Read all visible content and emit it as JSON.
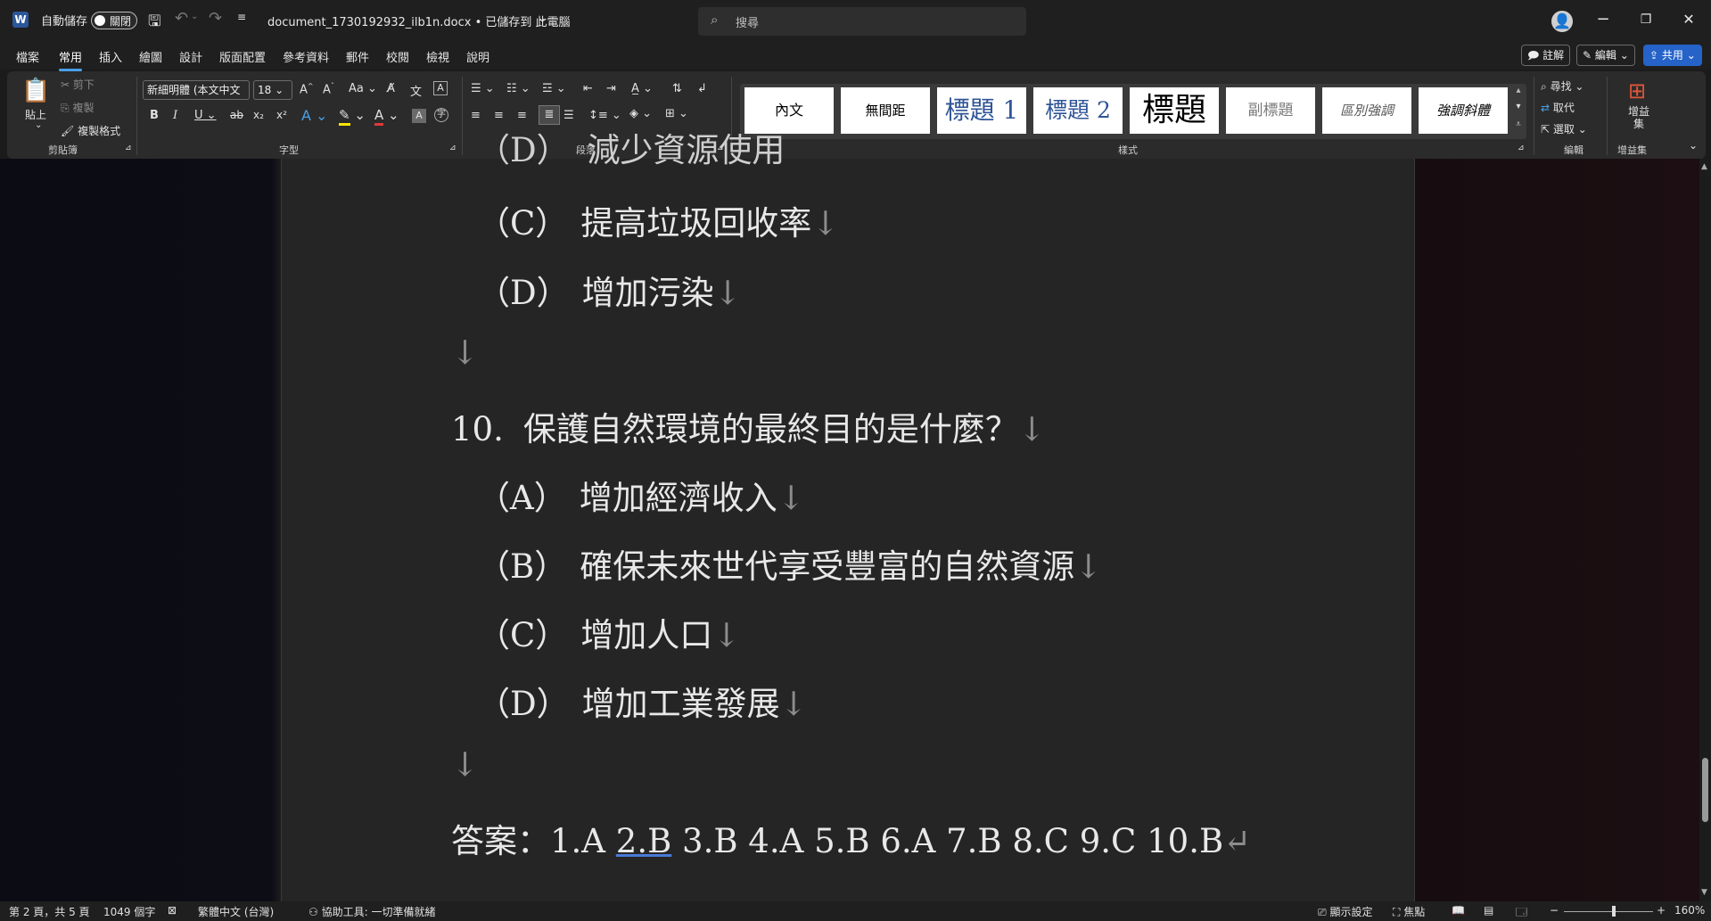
{
  "titlebar": {
    "autosave_label": "自動儲存",
    "autosave_state": "關閉",
    "doc_title": "document_1730192932_ilb1n.docx • 已儲存到 此電腦",
    "search_placeholder": "搜尋",
    "minimize": "−",
    "restore": "❐",
    "close": "✕"
  },
  "menu": {
    "tabs": [
      "檔案",
      "常用",
      "插入",
      "繪圖",
      "設計",
      "版面配置",
      "參考資料",
      "郵件",
      "校閱",
      "檢視",
      "說明"
    ],
    "active": "常用",
    "comments": "註解",
    "editing": "編輯",
    "share": "共用"
  },
  "ribbon": {
    "clipboard": {
      "paste": "貼上",
      "cut": "剪下",
      "copy": "複製",
      "format_painter": "複製格式",
      "label": "剪貼簿"
    },
    "font": {
      "name": "新細明體 (本文中文",
      "size": "18",
      "label": "字型",
      "grow": "A^",
      "shrink": "Aˇ",
      "case": "Aa"
    },
    "paragraph": {
      "label": "段落"
    },
    "styles": {
      "label": "樣式",
      "items": [
        "內文",
        "無間距",
        "標題 1",
        "標題 2",
        "標題",
        "副標題",
        "區別強調",
        "強調斜體"
      ]
    },
    "editing": {
      "find": "尋找",
      "replace": "取代",
      "select": "選取",
      "label": "編輯"
    },
    "addins": {
      "button": "增益集",
      "label": "增益集"
    }
  },
  "document": {
    "lines": [
      {
        "label": "（C）",
        "text": "提高垃圾回收率",
        "mark": "↓"
      },
      {
        "label": "（D）",
        "text": "增加污染",
        "mark": "↓"
      },
      {
        "label": "",
        "text": "",
        "mark": "↓"
      },
      {
        "label": "10.",
        "text": "保護自然環境的最終目的是什麼？",
        "mark": "↓"
      },
      {
        "label": "（A）",
        "text": "增加經濟收入",
        "mark": "↓"
      },
      {
        "label": "（B）",
        "text": "確保未來世代享受豐富的自然資源",
        "mark": "↓"
      },
      {
        "label": "（C）",
        "text": "增加人口",
        "mark": "↓"
      },
      {
        "label": "（D）",
        "text": "增加工業發展",
        "mark": "↓"
      },
      {
        "label": "",
        "text": "",
        "mark": "↓"
      }
    ],
    "answer_prefix": "答案：1.A ",
    "answer_underlined": "2.B",
    "answer_rest": " 3.B 4.A 5.B 6.A 7.B 8.C 9.C 10.B",
    "answer_mark": "↵"
  },
  "status": {
    "page": "第 2 頁，共 5 頁",
    "words": "1049 個字",
    "language": "繁體中文 (台灣)",
    "accessibility": "協助工具: 一切準備就緒",
    "display_settings": "顯示設定",
    "focus": "焦點",
    "zoom": "160%"
  },
  "colors": {
    "accent": "#4aa0e6",
    "share": "#2563c9",
    "word_blue": "#2b579a"
  }
}
